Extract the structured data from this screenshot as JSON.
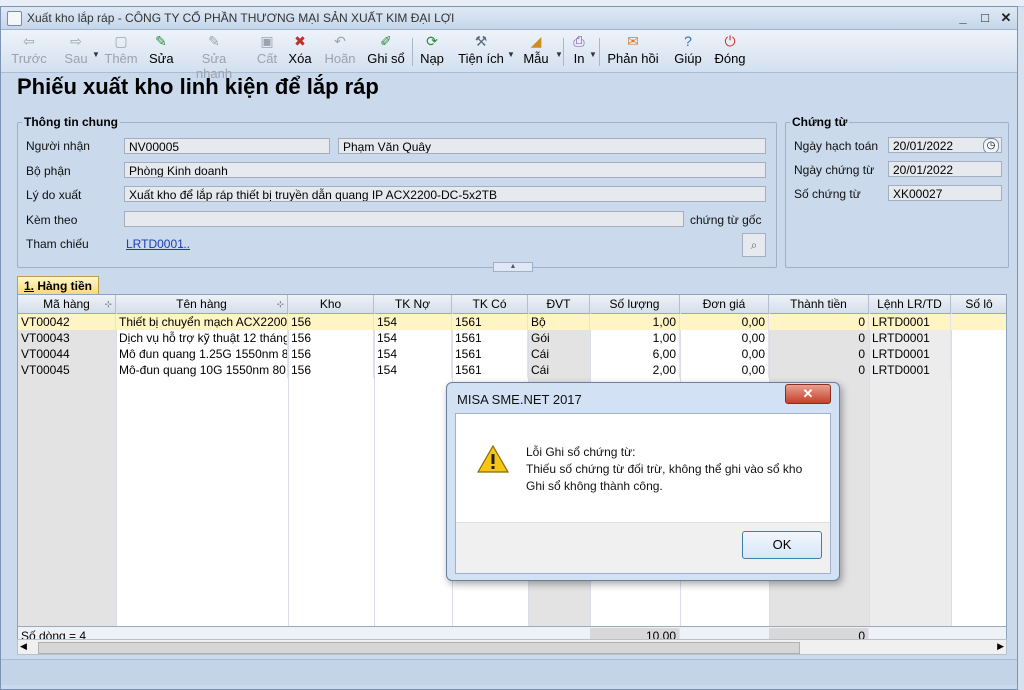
{
  "window": {
    "title": "Xuất kho lắp ráp - CÔNG TY CỔ PHẦN THƯƠNG MẠI SẢN XUẤT KIM ĐẠI LỢI",
    "minimize": "_",
    "maximize": "□",
    "close": "✕"
  },
  "toolbar": {
    "prev": "Trước",
    "next": "Sau",
    "add": "Thêm",
    "edit": "Sửa",
    "quick_edit": "Sửa nhanh",
    "save": "Cất",
    "delete": "Xóa",
    "undo": "Hoãn",
    "post": "Ghi sổ",
    "reload": "Nạp",
    "utilities": "Tiện ích",
    "template": "Mẫu",
    "print": "In",
    "feedback": "Phản hồi",
    "help": "Giúp",
    "close": "Đóng"
  },
  "form": {
    "title": "Phiếu xuất kho linh kiện để lắp ráp",
    "general_info": {
      "group_label": "Thông tin chung",
      "recipient_label": "Người nhận",
      "recipient_code": "NV00005",
      "recipient_name": "Phạm Văn Quây",
      "department_label": "Bộ phận",
      "department": "Phòng Kinh doanh",
      "reason_label": "Lý do xuất",
      "reason": "Xuất kho để lắp ráp thiết bị truyền dẫn quang IP ACX2200-DC-5x2TB",
      "attach_label": "Kèm theo",
      "attach_value": "",
      "attach_suffix": "chứng từ gốc",
      "reference_label": "Tham chiếu",
      "reference": "LRTD0001",
      "reference_more": "..."
    },
    "voucher": {
      "group_label": "Chứng từ",
      "posting_date_label": "Ngày hạch toán",
      "posting_date": "20/01/2022",
      "voucher_date_label": "Ngày chứng từ",
      "voucher_date": "20/01/2022",
      "voucher_no_label": "Số chứng từ",
      "voucher_no": "XK00027"
    }
  },
  "tab": {
    "number": "1.",
    "label": "Hàng tiền"
  },
  "grid": {
    "columns": [
      "Mã hàng",
      "Tên hàng",
      "Kho",
      "TK Nợ",
      "TK Có",
      "ĐVT",
      "Số lượng",
      "Đơn giá",
      "Thành tiền",
      "Lệnh LR/TD",
      "Số lô"
    ],
    "rows": [
      [
        "VT00042",
        "Thiết bị chuyển mạch ACX2200",
        "156",
        "154",
        "1561",
        "Bộ",
        "1,00",
        "0,00",
        "0",
        "LRTD0001",
        ""
      ],
      [
        "VT00043",
        "Dịch vụ hỗ trợ kỹ thuật 12 tháng",
        "156",
        "154",
        "1561",
        "Gói",
        "1,00",
        "0,00",
        "0",
        "LRTD0001",
        ""
      ],
      [
        "VT00044",
        "Mô đun quang 1.25G 1550nm 8",
        "156",
        "154",
        "1561",
        "Cái",
        "6,00",
        "0,00",
        "0",
        "LRTD0001",
        ""
      ],
      [
        "VT00045",
        "Mô-đun quang 10G 1550nm 80",
        "156",
        "154",
        "1561",
        "Cái",
        "2,00",
        "0,00",
        "0",
        "LRTD0001",
        ""
      ]
    ],
    "footer": {
      "row_count": "Số dòng = 4",
      "total_quantity": "10,00",
      "total_amount": "0"
    }
  },
  "dialog": {
    "title": "MISA SME.NET 2017",
    "close": "✕",
    "line1": "Lỗi Ghi sổ chứng từ:",
    "line2": "Thiếu số chứng từ đối trừ, không thể ghi vào sổ kho",
    "line3": "Ghi sổ không thành công.",
    "ok": "OK"
  }
}
